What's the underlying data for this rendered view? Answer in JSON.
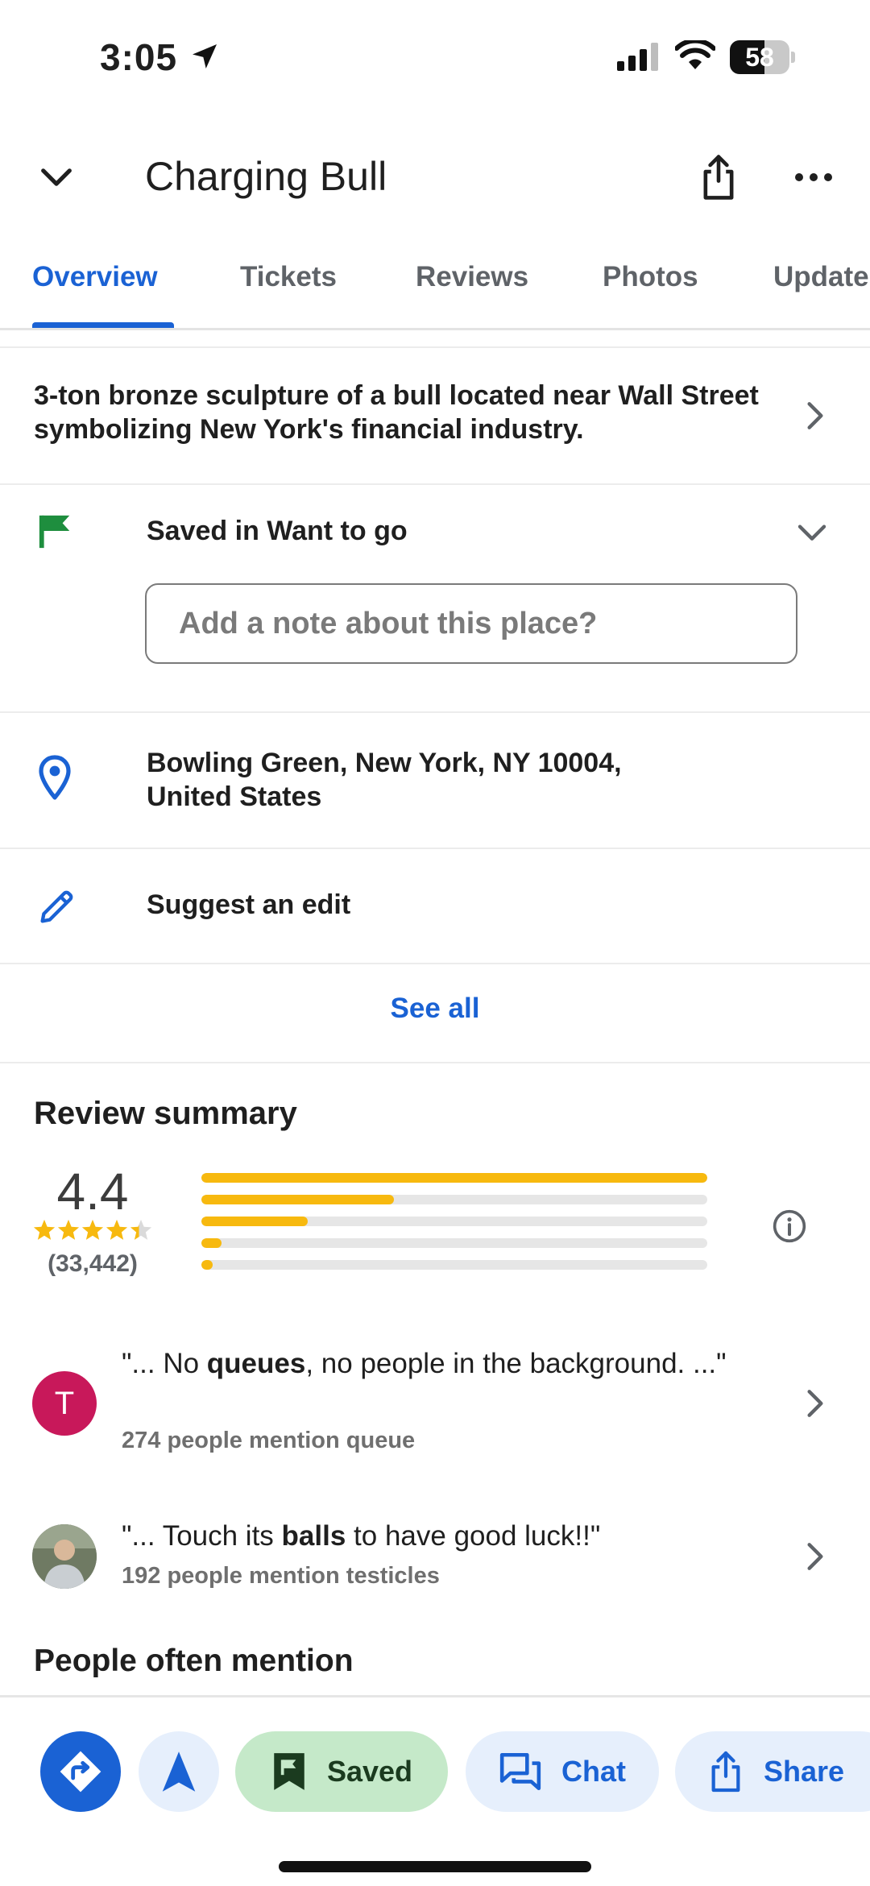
{
  "status_bar": {
    "time": "3:05",
    "battery": "58",
    "battery_level": 0.58
  },
  "header": {
    "title": "Charging Bull"
  },
  "tabs": [
    {
      "label": "Overview",
      "active": true
    },
    {
      "label": "Tickets",
      "active": false
    },
    {
      "label": "Reviews",
      "active": false
    },
    {
      "label": "Photos",
      "active": false
    },
    {
      "label": "Updates",
      "active": false
    }
  ],
  "overview": {
    "description": "3-ton bronze sculpture of a bull located near Wall Street symbolizing New York's financial industry.",
    "saved_label": "Saved in Want to go",
    "note_placeholder": "Add a note about this place?",
    "address_line1": "Bowling Green, New York, NY 10004,",
    "address_line2": "United States",
    "suggest_edit": "Suggest an edit",
    "see_all": "See all"
  },
  "review_summary": {
    "title": "Review summary",
    "rating": "4.4",
    "rating_value": 4.4,
    "count": "(33,442)",
    "distribution": [
      {
        "stars": 5,
        "fraction": 1.0
      },
      {
        "stars": 4,
        "fraction": 0.38
      },
      {
        "stars": 3,
        "fraction": 0.21
      },
      {
        "stars": 2,
        "fraction": 0.04
      },
      {
        "stars": 1,
        "fraction": 0.02
      }
    ]
  },
  "snippets": [
    {
      "avatar_letter": "T",
      "quote_prefix": "\"... No ",
      "quote_bold": "queues",
      "quote_suffix": ", no people in the background. ...\"",
      "mention": "274 people mention queue"
    },
    {
      "quote_prefix": "\"... Touch its ",
      "quote_bold": "balls",
      "quote_suffix": " to have good luck!!\"",
      "mention": "192 people mention testicles"
    }
  ],
  "people_often_mention": "People often mention",
  "actions": {
    "saved": "Saved",
    "chat": "Chat",
    "share": "Share"
  },
  "colors": {
    "accent": "#1a62d4",
    "star": "#f7b90f",
    "flag": "#1e8e3e",
    "saved_bg": "#c5e9c9"
  },
  "icons": [
    "location-arrow-icon",
    "signal-icon",
    "wifi-icon",
    "battery-icon",
    "chevron-down-icon",
    "share-icon",
    "more-icon",
    "chevron-right-icon",
    "flag-icon",
    "pin-icon",
    "pencil-icon",
    "info-icon",
    "directions-icon",
    "navigation-icon",
    "bookmark-flag-icon",
    "chat-icon"
  ]
}
